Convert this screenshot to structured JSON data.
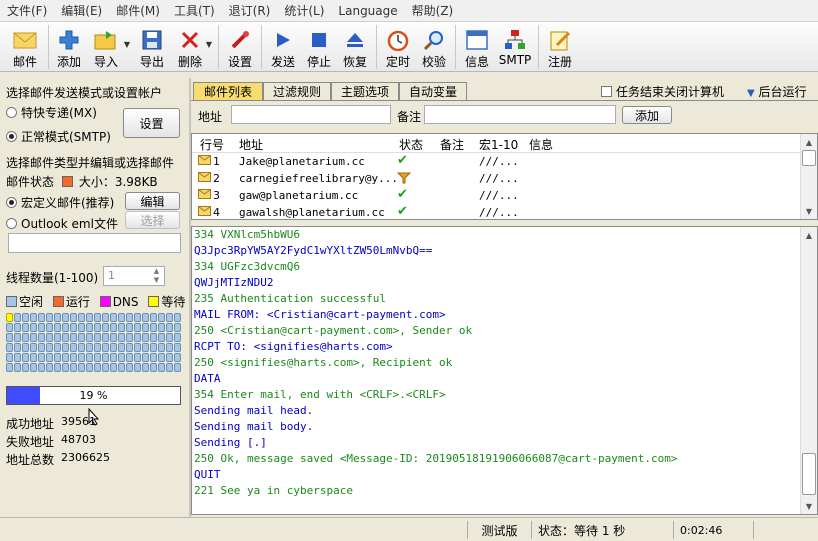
{
  "menu": [
    "文件(F)",
    "编辑(E)",
    "邮件(M)",
    "工具(T)",
    "退订(R)",
    "统计(L)",
    "Language",
    "帮助(Z)"
  ],
  "toolbar": {
    "mail": "邮件",
    "add": "添加",
    "import": "导入",
    "export": "导出",
    "delete": "删除",
    "settings": "设置",
    "send": "发送",
    "stop": "停止",
    "restore": "恢复",
    "timer": "定时",
    "verify": "校验",
    "info": "信息",
    "smtp": "SMTP",
    "register": "注册"
  },
  "left": {
    "send_mode_title": "选择邮件发送模式或设置帐户",
    "mode_express": "特快专递(MX)",
    "mode_normal": "正常模式(SMTP)",
    "settings_btn": "设置",
    "type_title": "选择邮件类型并编辑或选择邮件",
    "mail_status_label": "邮件状态",
    "size_label": "大小：3.98KB",
    "custom_mail": "宏定义邮件(推荐)",
    "edit_btn": "编辑",
    "outlook_eml": "Outlook eml文件",
    "select_btn": "选择",
    "thread_label": "线程数量(1-100)",
    "thread_value": "1",
    "legend": {
      "idle": "空闲",
      "running": "运行",
      "dns": "DNS",
      "waiting": "等待"
    },
    "progress": 19,
    "progress_text": "19 %",
    "success_label": "成功地址",
    "success_value": "39561",
    "fail_label": "失败地址",
    "fail_value": "48703",
    "total_label": "地址总数",
    "total_value": "2306625"
  },
  "right": {
    "tabs": [
      "邮件列表",
      "过滤规则",
      "主题选项",
      "自动变量"
    ],
    "shutdown_label": "任务结束关闭计算机",
    "background_label": "后台运行",
    "addr_label": "地址",
    "note_label": "备注",
    "add_btn": "添加",
    "columns": [
      "行号",
      "地址",
      "状态",
      "备注",
      "宏1-10",
      "信息"
    ],
    "rows": [
      {
        "num": "1",
        "addr": "Jake@planetarium.cc",
        "macro": "///..."
      },
      {
        "num": "2",
        "addr": "carnegiefreelibrary@y...",
        "macro": "///..."
      },
      {
        "num": "3",
        "addr": "gaw@planetarium.cc",
        "macro": "///..."
      },
      {
        "num": "4",
        "addr": "gawalsh@planetarium.cc",
        "macro": "///..."
      }
    ]
  },
  "log": [
    {
      "text": "334 VXNlcm5hbWU6",
      "c": "g"
    },
    {
      "text": "Q3Jpc3RpYW5AY2FydC1wYXltZW50LmNvbQ==",
      "c": "b"
    },
    {
      "text": "334 UGFzc3dvcmQ6",
      "c": "g"
    },
    {
      "text": "QWJjMTIzNDU2",
      "c": "b"
    },
    {
      "text": "235 Authentication successful",
      "c": "g"
    },
    {
      "text": "MAIL FROM: <Cristian@cart-payment.com>",
      "c": "b"
    },
    {
      "text": "250 <Cristian@cart-payment.com>, Sender ok",
      "c": "g"
    },
    {
      "text": "RCPT TO: <signifies@harts.com>",
      "c": "b"
    },
    {
      "text": "250 <signifies@harts.com>, Recipient ok",
      "c": "g"
    },
    {
      "text": "DATA",
      "c": "b"
    },
    {
      "text": "354 Enter mail, end with <CRLF>.<CRLF>",
      "c": "g"
    },
    {
      "text": "Sending mail head.",
      "c": "b"
    },
    {
      "text": "Sending mail body.",
      "c": "b"
    },
    {
      "text": "Sending [.]",
      "c": "b"
    },
    {
      "text": "250 Ok, message saved <Message-ID: 20190518191906066087@cart-payment.com>",
      "c": "g"
    },
    {
      "text": "QUIT",
      "c": "b"
    },
    {
      "text": "221 See ya in cyberspace",
      "c": "g"
    }
  ],
  "status": {
    "edition": "测试版",
    "state": "状态：等待 1 秒",
    "time": "0:02:46"
  },
  "colors": {
    "log_green": "#1a8a1a",
    "log_blue": "#0000cc",
    "active_tab": "#f7dd6f",
    "progress_fill": "#3f4cff",
    "mail_status": "#f26b2a"
  }
}
